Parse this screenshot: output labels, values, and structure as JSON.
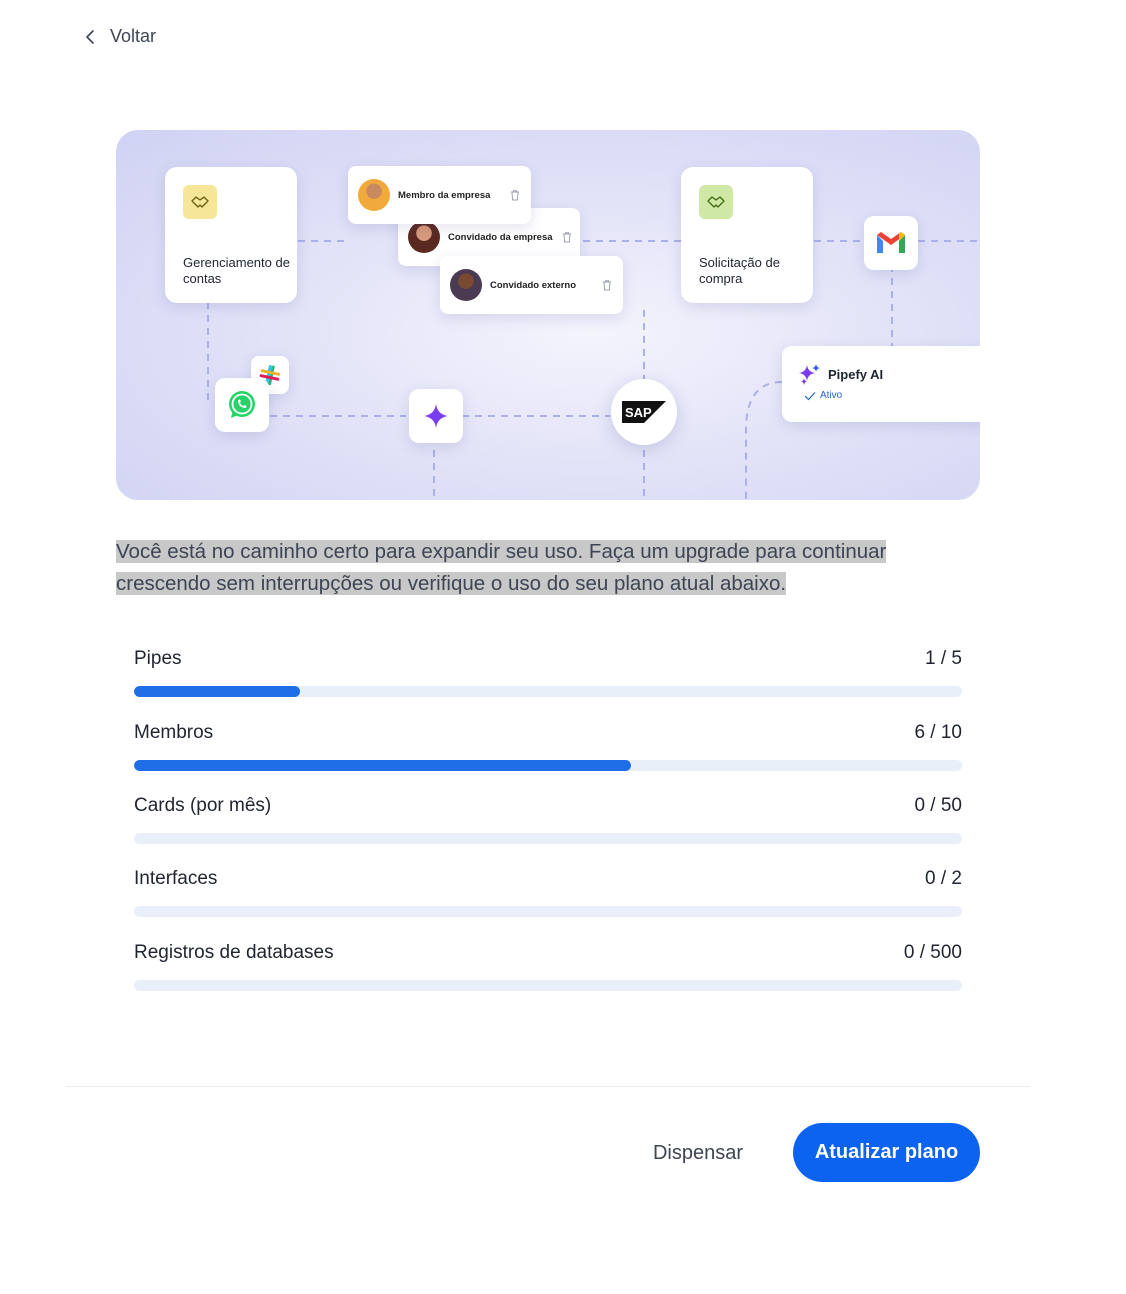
{
  "nav": {
    "back_label": "Voltar"
  },
  "hero": {
    "card_accounts": "Gerenciamento de contas",
    "card_purchase": "Solicitação de compra",
    "chip_member": "Membro da empresa",
    "chip_guest": "Convidado da empresa",
    "chip_external": "Convidado externo",
    "ai_title": "Pipefy AI",
    "ai_status": "Ativo",
    "sap_label": "SAP"
  },
  "description": "Você está no caminho certo para expandir seu uso. Faça um upgrade para continuar crescendo sem interrupções ou verifique o uso do seu plano atual abaixo.",
  "usage": [
    {
      "label": "Pipes",
      "value": "1 / 5",
      "used": 1,
      "limit": 5
    },
    {
      "label": "Membros",
      "value": "6 / 10",
      "used": 6,
      "limit": 10
    },
    {
      "label": "Cards (por mês)",
      "value": "0 / 50",
      "used": 0,
      "limit": 50
    },
    {
      "label": "Interfaces",
      "value": "0 / 2",
      "used": 0,
      "limit": 2
    },
    {
      "label": "Registros de databases",
      "value": "0 / 500",
      "used": 0,
      "limit": 500
    }
  ],
  "footer": {
    "dismiss_label": "Dispensar",
    "upgrade_label": "Atualizar plano"
  },
  "colors": {
    "primary": "#0b63f0",
    "progress_fill": "#1f6ee8",
    "progress_track": "#e8eff9"
  }
}
